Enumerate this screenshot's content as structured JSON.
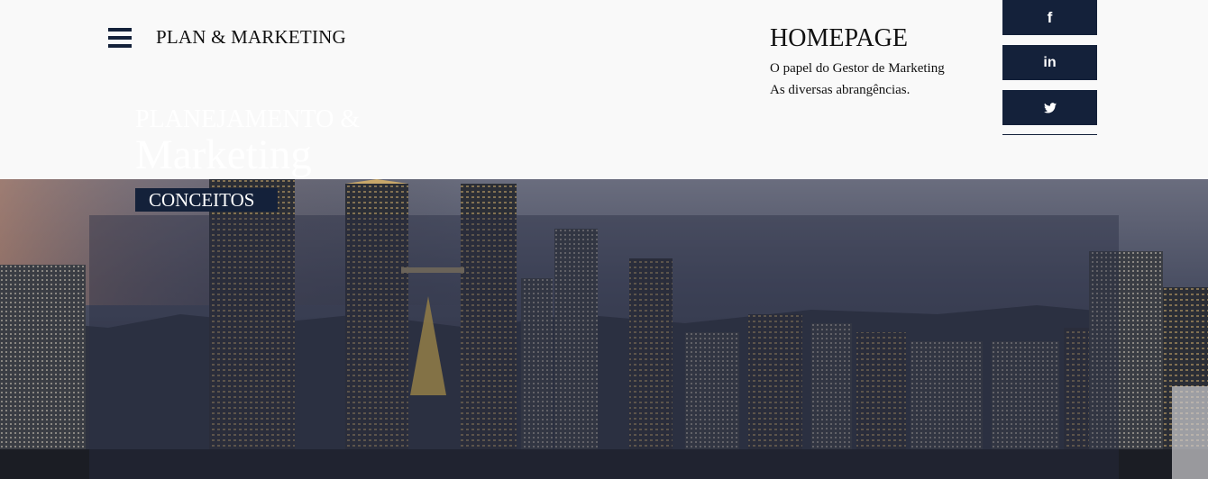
{
  "header": {
    "menu_icon": "hamburger-menu-icon",
    "brand": "PLAN & MARKETING",
    "home_title": "HOMEPAGE",
    "links": [
      "O papel do Gestor de Marketing",
      "As diversas abrangências."
    ]
  },
  "social": {
    "facebook": "f",
    "linkedin": "in",
    "twitter": "twitter-bird-icon",
    "color": "#14213a"
  },
  "hero": {
    "line1": "PLANEJAMENTO &",
    "line2": "Marketing",
    "badge": "CONCEITOS",
    "background": "city-skyline-at-dusk"
  }
}
